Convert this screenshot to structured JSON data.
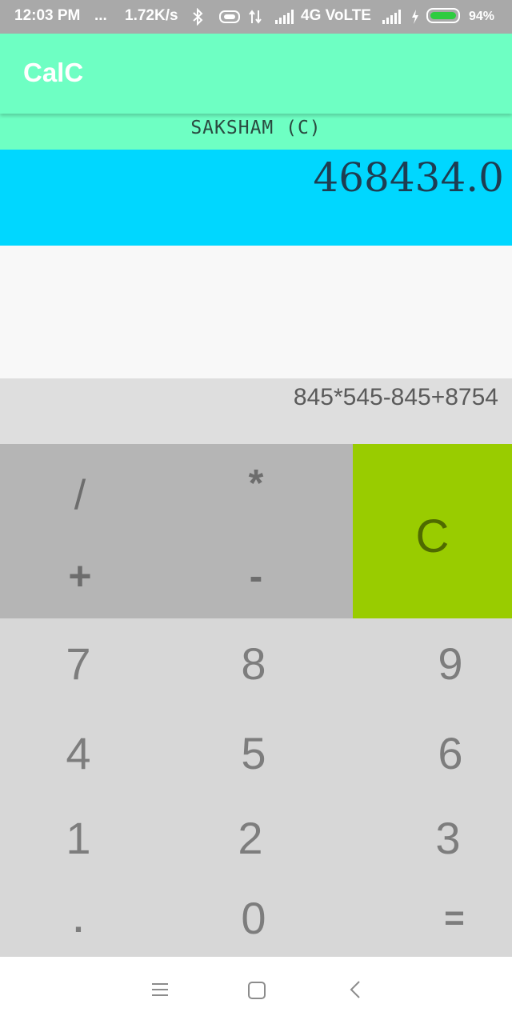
{
  "status_bar": {
    "time": "12:03 PM",
    "dots": "...",
    "speed": "1.72K/s",
    "network": "4G VoLTE",
    "battery": "94%",
    "battery_level": 0.94,
    "icons": [
      "bluetooth-icon",
      "vibrate-icon",
      "data-arrows-icon",
      "signal-icon",
      "charging-icon",
      "battery-icon"
    ]
  },
  "app_bar": {
    "title": "CalC"
  },
  "author": {
    "label": "SAKSHAM (C)"
  },
  "display": {
    "result": "468434.0",
    "expression": "845*545-845+8754"
  },
  "operators": {
    "divide": "/",
    "multiply": "*",
    "add": "+",
    "subtract": "-",
    "clear": "C"
  },
  "keypad": {
    "rows": [
      [
        "7",
        "8",
        "9"
      ],
      [
        "4",
        "5",
        "6"
      ],
      [
        "1",
        "2",
        "3"
      ],
      [
        ".",
        "0",
        "="
      ]
    ]
  },
  "nav": {
    "icons": [
      "menu-icon",
      "home-icon",
      "back-icon"
    ]
  },
  "colors": {
    "app_bar": "#6effc3",
    "result_bg": "#00d7ff",
    "clear_bg": "#99cc00",
    "operator_bg": "#b5b5b5",
    "keypad_bg": "#d7d7d7"
  }
}
